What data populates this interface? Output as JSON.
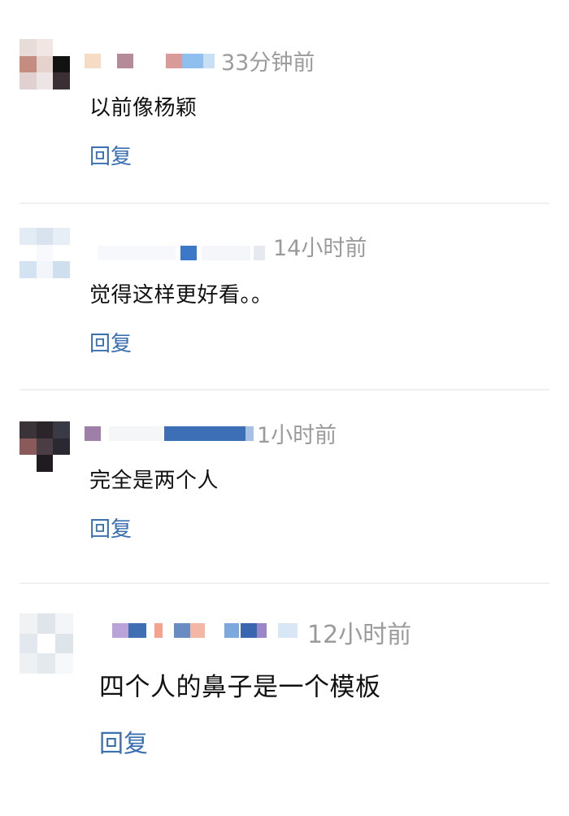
{
  "comments": [
    {
      "time": "33分钟前",
      "text": "以前像杨颖",
      "reply": "回复"
    },
    {
      "time": "14小时前",
      "text": "觉得这样更好看。。",
      "reply": "回复"
    },
    {
      "time": "1小时前",
      "text": "完全是两个人",
      "reply": "回复"
    },
    {
      "time": "12小时前",
      "text": "四个人的鼻子是一个模板",
      "reply": "回复"
    }
  ],
  "colors": {
    "reply_link": "#3a6fb0",
    "timestamp": "#9b9b9b",
    "divider": "#f0f0f0"
  }
}
